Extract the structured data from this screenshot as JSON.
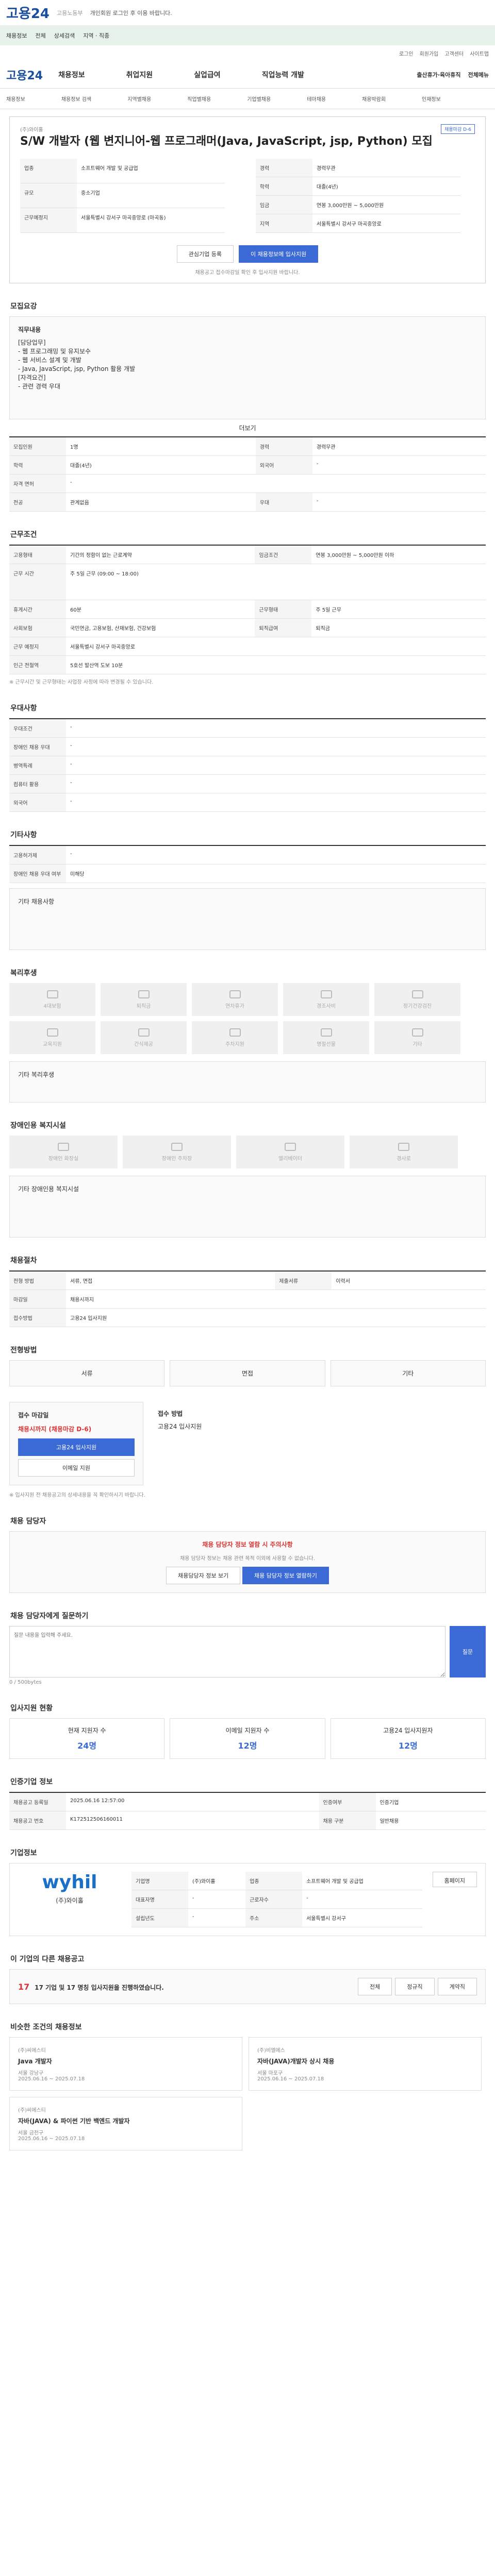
{
  "topbar": {
    "logo": "고용24",
    "sub": "고용노동부",
    "notice": "개인회원 로그인 후 이용 바랍니다.",
    "link": "로그인 페이지 바로가기"
  },
  "greenbar": {
    "items": [
      "채용정보",
      "전체",
      "상세검색",
      "지역 · 직종"
    ]
  },
  "util": [
    "로그인",
    "회원가입",
    "고객센터",
    "사이트맵"
  ],
  "gnb": {
    "brand": "고용24",
    "menu": [
      "채용정보",
      "취업지원",
      "실업급여",
      "직업능력 개발"
    ],
    "right": [
      "출산휴가·육아휴직",
      "전체메뉴"
    ]
  },
  "lnb": [
    "채용정보",
    "채용정보 검색",
    "지역별채용",
    "직업별채용",
    "기업별채용",
    "테마채용",
    "채용박람회",
    "인재정보"
  ],
  "job": {
    "badge": "채용정보",
    "views": "채용마감 D-6",
    "title": "S/W 개발자 (웹 변지니어-웹 프로그래머(Java, JavaScript, jsp, Python) 모집",
    "company": "기업정보",
    "company_name": "(주)와이홀",
    "rows": [
      [
        "업종",
        "소프트웨어 개발 및 공급업"
      ],
      [
        "규모",
        "중소기업"
      ],
      [
        "근무예정지",
        "서울특별시 강서구 마곡중앙로 (마곡동)"
      ]
    ],
    "cond_title": "근무조건",
    "cond": [
      [
        "경력",
        "경력무관"
      ],
      [
        "학력",
        "대졸(4년)"
      ],
      [
        "임금",
        "연봉 3,000만원 ~ 5,000만원"
      ],
      [
        "지역",
        "서울특별시 강서구 마곡중앙로"
      ]
    ],
    "cond2_title": "복리후생",
    "cond2": [
      [
        "고용형태",
        "기간의 정함이 없는 근로계약"
      ],
      [
        "근무형태",
        "주 5일 근무"
      ]
    ],
    "apply_label": "관심기업 등록",
    "apply_btn": "이 채용정보에 입사지원",
    "note": "채용공고 접수마감일 확인 후 입사지원 바랍니다."
  },
  "detail": {
    "title": "모집요강",
    "duties_label": "직무내용",
    "duties": [
      "[담당업무]",
      "- 웹 프로그래밍 및 유지보수",
      "- 웹 서비스 설계 및 개발",
      "- Java, JavaScript, jsp, Python 활용 개발",
      "[자격요건]",
      "- 관련 경력 우대"
    ],
    "more": "더보기",
    "rows": [
      [
        "모집인원",
        "1명",
        "경력",
        "경력무관"
      ],
      [
        "학력",
        "대졸(4년)",
        "외국어",
        "-"
      ],
      [
        "자격 면허",
        "-",
        "",
        ""
      ],
      [
        "전공",
        "관계없음",
        "우대",
        "-"
      ]
    ]
  },
  "work": {
    "title": "근무조건",
    "rows": [
      [
        "고용형태",
        "기간의 정함이 없는 근로계약",
        "임금조건",
        "연봉 3,000만원 ~ 5,000만원 이하"
      ],
      [
        "근무 시간",
        "주 5일 근무 (09:00 ~ 18:00)",
        "",
        ""
      ],
      [
        "휴게시간",
        "60분",
        "근무형태",
        "주 5일 근무"
      ],
      [
        "사회보험",
        "국민연금, 고용보험, 산재보험, 건강보험",
        "퇴직급여",
        "퇴직금"
      ],
      [
        "근무 예정지",
        "서울특별시 강서구 마곡중앙로",
        "",
        ""
      ],
      [
        "인근 전철역",
        "5호선 발산역 도보 10분",
        "",
        ""
      ]
    ],
    "note": "※ 근무시간 및 근무형태는 사업장 사정에 따라 변경될 수 있습니다."
  },
  "priority": {
    "title": "우대사항",
    "rows": [
      [
        "우대조건",
        "-"
      ],
      [
        "장애인 채용 우대",
        "-"
      ],
      [
        "병역특례",
        "-"
      ],
      [
        "컴퓨터 활용",
        "-"
      ],
      [
        "외국어",
        "-"
      ]
    ]
  },
  "etc": {
    "title": "기타사항",
    "rows": [
      [
        "고용허가제",
        "-"
      ],
      [
        "장애인 채용 우대 여부",
        "미해당"
      ]
    ],
    "link": "기타 채용사항"
  },
  "welfare": {
    "title": "복리후생",
    "items": [
      "4대보험",
      "퇴직금",
      "연차휴가",
      "경조사비",
      "정기건강검진",
      "교육지원",
      "간식제공",
      "주차지원",
      "명절선물",
      "기타"
    ],
    "sub": "기타 복리후생"
  },
  "disabled": {
    "title": "장애인용 복지시설",
    "items": [
      "장애인 화장실",
      "장애인 주차장",
      "엘리베이터",
      "경사로"
    ],
    "sub": "기타 장애인용 복지시설"
  },
  "recruit": {
    "title": "채용절차",
    "rows": [
      [
        "전형 방법",
        "서류, 면접",
        "제출서류",
        "이력서"
      ],
      [
        "마감일",
        "채용시까지",
        "",
        ""
      ],
      [
        "접수방법",
        "고용24 입사지원",
        "",
        ""
      ]
    ]
  },
  "apply": {
    "title": "전형방법",
    "items": [
      "서류",
      "면접",
      "기타"
    ],
    "contact_title": "접수 마감일",
    "deadline": "채용시까지 (채용마감 D-6)",
    "apply_btn": "고용24 입사지원",
    "email_btn": "이메일 지원",
    "way_title": "접수 방법",
    "way": "고용24 입사지원",
    "note": "※ 입사지원 전 채용공고의 상세내용을 꼭 확인하시기 바랍니다."
  },
  "contact": {
    "title": "채용 담당자",
    "warn": "채용 담당자 정보 열람 시 주의사항",
    "text": "채용 담당자 정보는 채용 관련 목적 이외에 사용할 수 없습니다.",
    "btn1": "채용담당자 정보 보기",
    "btn2": "채용 담당자 정보 열람하기"
  },
  "qna": {
    "title": "채용 담당자에게 질문하기",
    "placeholder": "질문 내용을 입력해 주세요.",
    "count": "0 / 500bytes",
    "btn": "질문"
  },
  "stats": {
    "title": "입사지원 현황",
    "items": [
      [
        "현재 지원자 수",
        "24명"
      ],
      [
        "이메일 지원자 수",
        "12명"
      ],
      [
        "고용24 입사지원자",
        "12명"
      ]
    ]
  },
  "info": {
    "title": "인증기업 정보",
    "rows": [
      [
        "채용공고 등록일",
        "2025.06.16 12:57:00",
        "인증여부",
        "인증기업"
      ],
      [
        "채용공고 번호",
        "K172512506160011",
        "채용 구분",
        "일반채용"
      ]
    ]
  },
  "corp": {
    "title": "기업정보",
    "logo": "wyhil",
    "name": "(주)와이홀",
    "rows": [
      [
        "기업명",
        "(주)와이홀",
        "업종",
        "소프트웨어 개발 및 공급업"
      ],
      [
        "대표자명",
        "-",
        "근로자수",
        "-"
      ],
      [
        "설립년도",
        "-",
        "주소",
        "서울특별시 강서구"
      ]
    ],
    "btn": "홈페이지"
  },
  "similar": {
    "title": "이 기업의 다른 채용공고",
    "count": "17",
    "desc": "17 기업 및 17 명칭 입사지원을 진행하였습니다.",
    "items": [
      "전체",
      "정규직",
      "계약직"
    ]
  },
  "related": {
    "title": "비슷한 조건의 채용정보",
    "cards": [
      [
        "(주)씨에스티",
        "Java 개발자",
        "서울 강남구",
        "2025.06.16 ~ 2025.07.18"
      ],
      [
        "(주)비엘에스",
        "자바(JAVA)개발자 상시 채용",
        "서울 마포구",
        "2025.06.16 ~ 2025.07.18"
      ],
      [
        "(주)씨에스티",
        "자바(JAVA) & 파이썬 기반 백엔드 개발자",
        "서울 금천구",
        "2025.06.16 ~ 2025.07.18"
      ]
    ]
  }
}
